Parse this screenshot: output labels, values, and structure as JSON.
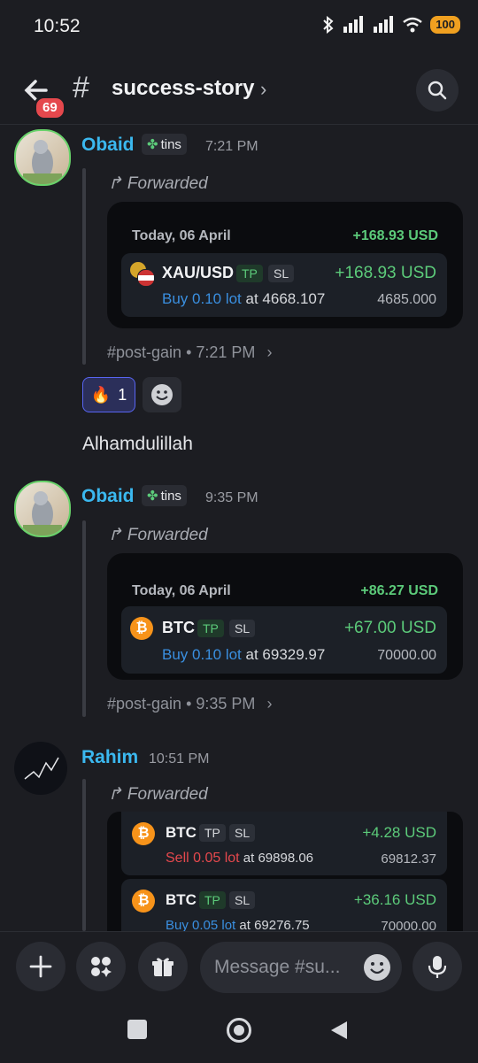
{
  "status_bar": {
    "time": "10:52",
    "battery": "100"
  },
  "header": {
    "unread_count": "69",
    "hash": "#",
    "channel_name": "success-story",
    "chevron": "›"
  },
  "messages": [
    {
      "author": "Obaid",
      "tag": "tins",
      "time": "7:21 PM",
      "forwarded_label": "Forwarded",
      "card": {
        "date": "Today, 06 April",
        "total": "+168.93 USD",
        "trades": [
          {
            "symbol": "XAU/USD",
            "tp": "TP",
            "sl": "SL",
            "gain": "+168.93 USD",
            "side_lot": "Buy 0.10 lot",
            "at": "at 4668.107",
            "close_price": "4685.000"
          }
        ]
      },
      "source_channel": "#post-gain",
      "source_time": "• 7:21 PM",
      "reaction": {
        "emoji": "🔥",
        "count": "1"
      }
    },
    {
      "text": "Alhamdulillah"
    },
    {
      "author": "Obaid",
      "tag": "tins",
      "time": "9:35 PM",
      "forwarded_label": "Forwarded",
      "card": {
        "date": "Today, 06 April",
        "total": "+86.27 USD",
        "trades": [
          {
            "symbol": "BTC",
            "tp": "TP",
            "sl": "SL",
            "gain": "+67.00 USD",
            "side_lot": "Buy 0.10 lot",
            "at": "at 69329.97",
            "close_price": "70000.00"
          }
        ]
      },
      "source_channel": "#post-gain",
      "source_time": "• 9:35 PM"
    },
    {
      "author": "Rahim",
      "time": "10:51 PM",
      "forwarded_label": "Forwarded",
      "card": {
        "trades": [
          {
            "symbol": "BTC",
            "tp": "TP",
            "sl": "SL",
            "gain": "+4.28 USD",
            "side_lot": "Sell 0.05 lot",
            "at": "at 69898.06",
            "close_price": "69812.37"
          },
          {
            "symbol": "BTC",
            "tp": "TP",
            "sl": "SL",
            "gain": "+36.16 USD",
            "side_lot": "Buy 0.05 lot",
            "at": "at 69276.75",
            "close_price": "70000.00"
          }
        ]
      }
    }
  ],
  "composer": {
    "placeholder": "Message #su..."
  },
  "colors": {
    "background": "#1c1d22",
    "accent_blue": "#3bb8ef",
    "gain_green": "#5ccb7a",
    "sell_red": "#e5484d",
    "buy_blue": "#3a8fe0"
  }
}
